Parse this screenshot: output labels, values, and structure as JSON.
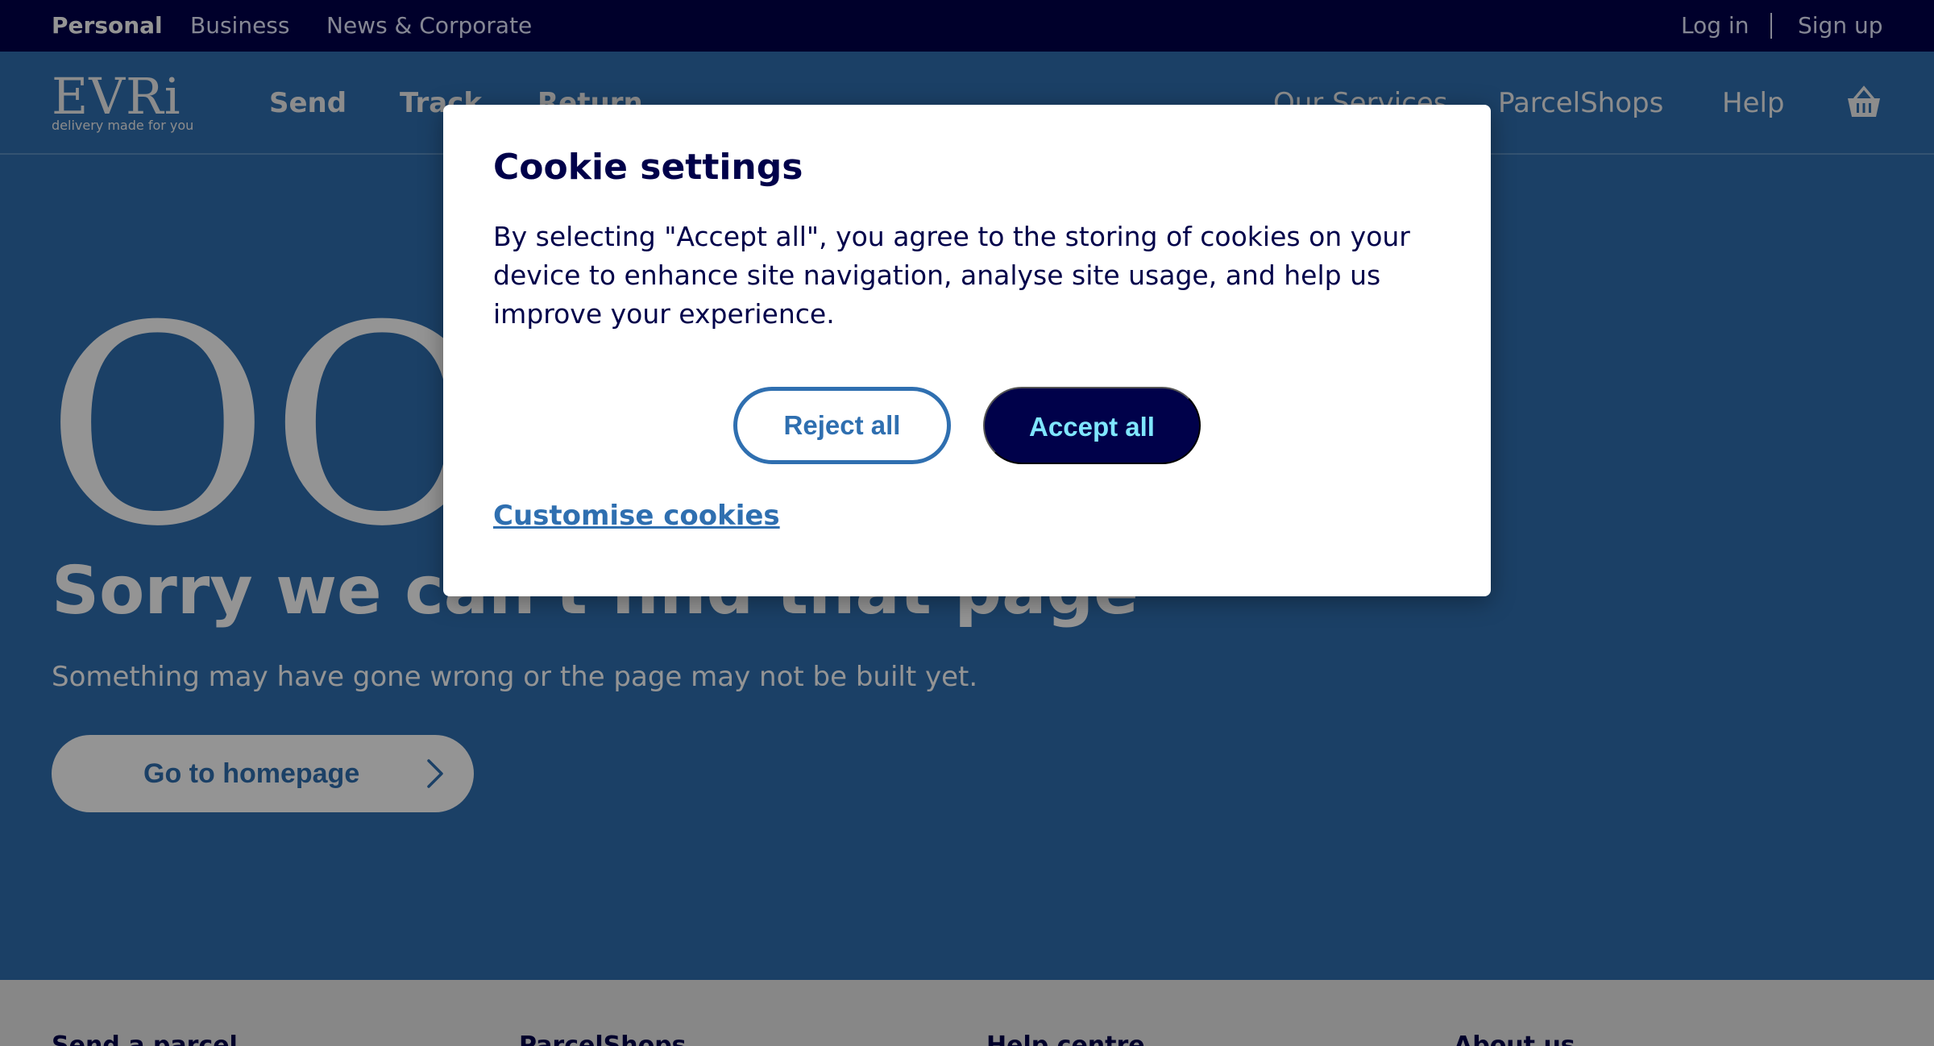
{
  "topbar": {
    "segments": [
      "Personal",
      "Business",
      "News & Corporate"
    ],
    "login": "Log in",
    "signup": "Sign up"
  },
  "nav": {
    "logo_word": "EVRi",
    "logo_tagline": "delivery made for you",
    "left_items": [
      "Send",
      "Track",
      "Return"
    ],
    "right_items": [
      "Our Services",
      "ParcelShops",
      "Help"
    ],
    "basket_icon": "basket-icon"
  },
  "hero": {
    "error_code_visible": "OO",
    "title": "Sorry we can't find that page",
    "subtitle": "Something may have gone wrong or the page may not be built yet.",
    "button_label": "Go to homepage"
  },
  "footer": {
    "columns": [
      "Send a parcel",
      "ParcelShops",
      "Help centre",
      "About us"
    ]
  },
  "cookie_modal": {
    "title": "Cookie settings",
    "message": "By selecting \"Accept all\", you agree to the storing of cookies on your device to enhance site navigation, analyse site usage, and help us improve your experience.",
    "reject_label": "Reject all",
    "accept_label": "Accept all",
    "customise_label": "Customise cookies"
  },
  "colors": {
    "navy": "#00014a",
    "brand_blue": "#2f6fb0",
    "accept_text": "#7fe6ff"
  }
}
